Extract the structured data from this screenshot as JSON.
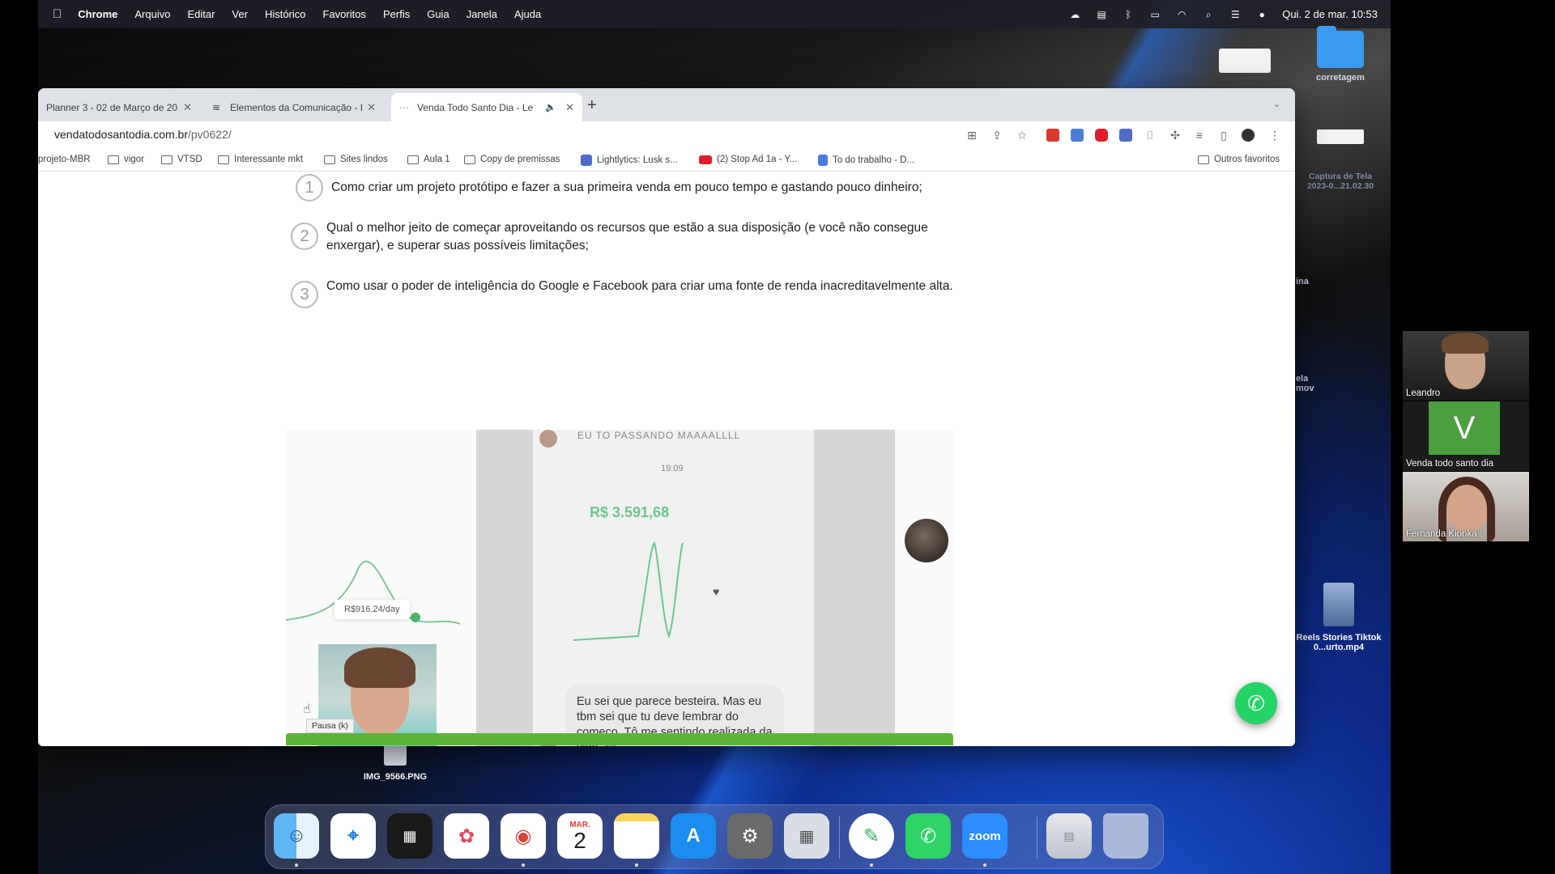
{
  "menubar": {
    "app_name": "Chrome",
    "items": [
      "Arquivo",
      "Editar",
      "Ver",
      "Histórico",
      "Favoritos",
      "Perfis",
      "Guia",
      "Janela",
      "Ajuda"
    ],
    "datetime": "Qui. 2 de mar.  10:53"
  },
  "desktop": {
    "folder_label": "corretagem",
    "capture_label": "Captura de Tela 2023-0...21.02.30",
    "partial_label_1": "ina",
    "partial_label_2": "ela\nmov",
    "reels_label": "Reels Stories Tiktok 0...urto.mp4",
    "img_label": "IMG_9566.PNG"
  },
  "tabs": [
    {
      "title": "Planner 3 - 02 de Março de 20",
      "active": false
    },
    {
      "title": "Elementos da Comunicação - I",
      "active": false
    },
    {
      "title": "Venda Todo Santo Dia - Le",
      "active": true
    }
  ],
  "address": {
    "domain": "vendatodosantodia.com.br",
    "path": "/pv0622/"
  },
  "bookmarks": [
    {
      "label": "projeto-MBR",
      "type": "plain"
    },
    {
      "label": "vigor",
      "type": "folder"
    },
    {
      "label": "VTSD",
      "type": "folder"
    },
    {
      "label": "Interessante mkt",
      "type": "folder"
    },
    {
      "label": "Sites lindos",
      "type": "folder"
    },
    {
      "label": "Aula 1",
      "type": "folder"
    },
    {
      "label": "Copy de premissas",
      "type": "folder"
    },
    {
      "label": "Lightlytics: Lusk s...",
      "type": "site"
    },
    {
      "label": "(2) Stop Ad 1a - Y...",
      "type": "youtube"
    },
    {
      "label": "To do trabalho - D...",
      "type": "doc"
    }
  ],
  "other_bookmarks": "Outros favoritos",
  "steps": [
    {
      "num": "1",
      "text": "Como criar um projeto protótipo e fazer a sua primeira venda em pouco tempo e gastando pouco dinheiro;"
    },
    {
      "num": "2",
      "text": "Qual o melhor jeito de começar aproveitando os recursos que estão a sua disposição (e você não consegue enxergar), e superar suas possíveis limitações;"
    },
    {
      "num": "3",
      "text": "Como usar o poder de inteligência do Google e Facebook para criar uma fonte de renda inacreditavelmente alta."
    }
  ],
  "video": {
    "phone_top_text": "EU TO PASSANDO MAAAALLLL",
    "phone_time": "19:09",
    "phone_price": "R$ 3.591,68",
    "left_price": "R$916.24/day",
    "chat_text": "Eu sei que parece besteira. Mas eu tbm sei que tu deve lembrar do começo. Tô me sentindo realizada da vida. 😊",
    "pause_tooltip": "Pausa (k)"
  },
  "participants": [
    {
      "name": "Leandro"
    },
    {
      "name": "Venda todo santo dia",
      "initial": "V"
    },
    {
      "name": "Fernanda Kionka"
    }
  ],
  "dock": {
    "calendar_month": "MAR.",
    "calendar_day": "2",
    "zoom_label": "zoom"
  },
  "colors": {
    "accent_green": "#5cb536",
    "whatsapp": "#25d366",
    "price_green": "#6cc78e"
  }
}
